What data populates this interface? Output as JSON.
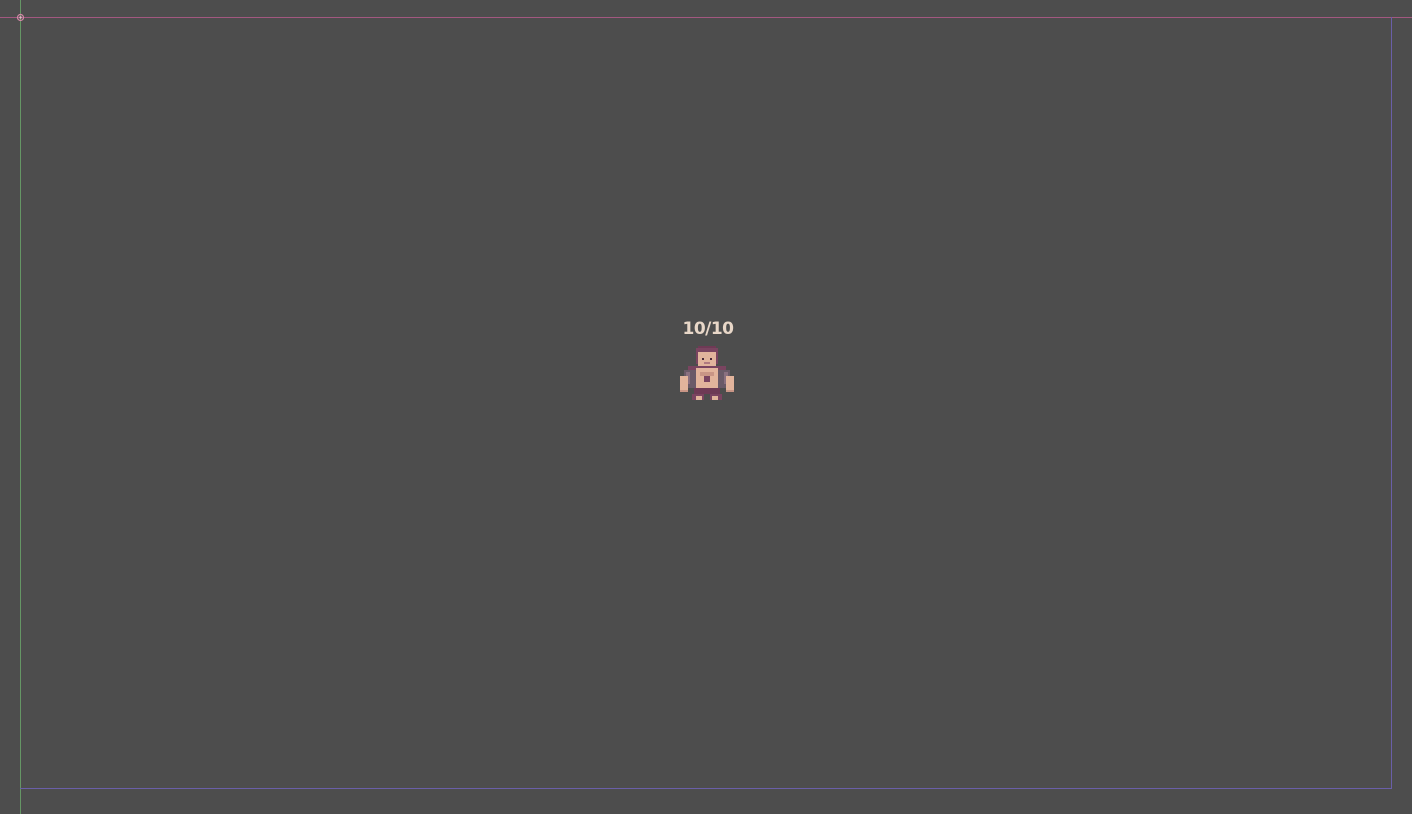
{
  "scene": {
    "background_color": "#4d4d4d",
    "guides": {
      "x_axis_color": "#b25a8a",
      "y_axis_color": "#6aa36a",
      "bounds_color": "#6a5fa8"
    }
  },
  "player": {
    "health_text": "10/10",
    "health_current": 10,
    "health_max": 10,
    "sprite_icon": "pixel-character-icon",
    "label_color": "#e8d7c8"
  }
}
